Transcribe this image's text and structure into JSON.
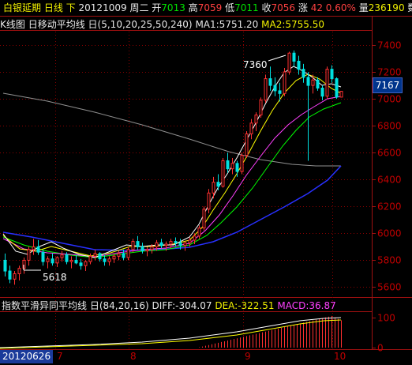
{
  "header": {
    "symbol": "白银延期",
    "period": "日线",
    "direction": "下",
    "date": "20121009",
    "weekday": "周二",
    "open_label": "开",
    "open": "7013",
    "high_label": "高",
    "high": "7059",
    "low_label": "低",
    "low": "7011",
    "close_label": "收",
    "close": "7056",
    "change_label": "涨",
    "change": "42",
    "change_pct": "0.60%",
    "volume_label": "量",
    "volume": "236190",
    "extra_label": "数",
    "extra": "16"
  },
  "ma_bar": {
    "chart_name": "K线图",
    "indicator": "日移动平均线",
    "indicator_params": "日(5,10,20,25,50,240)",
    "ma1": "MA1:5751.20",
    "ma2": "MA2:5755.50"
  },
  "macd_bar": {
    "indicator": "指数平滑异同平均线",
    "params": "日(84,20,16)",
    "diff": "DIFF:-304.07",
    "dea": "DEA:-322.51",
    "macd": "MACD:36.87"
  },
  "price_axis": {
    "ticks": [
      "7400",
      "7200",
      "7000",
      "6800",
      "6600",
      "6400",
      "6200",
      "6000",
      "5800",
      "5600"
    ],
    "current": "7167"
  },
  "macd_axis": {
    "ticks": [
      "100",
      "0"
    ]
  },
  "time_axis": {
    "labels": [
      "2",
      "7",
      "8",
      "9",
      "10"
    ],
    "start_date": "20120626"
  },
  "annotations": {
    "high": "7360",
    "low": "5618"
  },
  "colors": {
    "background": "#000000",
    "up_candle": "#ff3030",
    "down_candle": "#00e0e0",
    "axis_red": "#a01010",
    "ma5": "#ffffff",
    "ma10": "#ffff00",
    "ma20": "#ff40ff",
    "ma25": "#00ff00",
    "ma50": "#3030ff",
    "ma240": "#808080"
  },
  "chart_data": {
    "type": "candlestick",
    "x_axis_months": [
      "7",
      "8",
      "9",
      "10"
    ],
    "ylim": [
      5550,
      7500
    ],
    "candles": [
      [
        5800,
        5850,
        5680,
        5720
      ],
      [
        5720,
        5760,
        5630,
        5660
      ],
      [
        5660,
        5720,
        5618,
        5700
      ],
      [
        5700,
        5760,
        5650,
        5740
      ],
      [
        5740,
        5820,
        5700,
        5800
      ],
      [
        5800,
        5900,
        5760,
        5880
      ],
      [
        5880,
        5960,
        5840,
        5900
      ],
      [
        5900,
        5950,
        5840,
        5860
      ],
      [
        5860,
        5880,
        5760,
        5790
      ],
      [
        5790,
        5830,
        5740,
        5810
      ],
      [
        5810,
        5850,
        5760,
        5780
      ],
      [
        5780,
        5830,
        5750,
        5820
      ],
      [
        5820,
        5870,
        5790,
        5840
      ],
      [
        5840,
        5860,
        5770,
        5790
      ],
      [
        5790,
        5830,
        5740,
        5800
      ],
      [
        5800,
        5840,
        5770,
        5780
      ],
      [
        5780,
        5810,
        5730,
        5760
      ],
      [
        5760,
        5800,
        5720,
        5790
      ],
      [
        5790,
        5850,
        5770,
        5830
      ],
      [
        5830,
        5880,
        5800,
        5850
      ],
      [
        5850,
        5860,
        5790,
        5810
      ],
      [
        5810,
        5840,
        5760,
        5790
      ],
      [
        5790,
        5830,
        5760,
        5810
      ],
      [
        5810,
        5850,
        5780,
        5830
      ],
      [
        5830,
        5870,
        5800,
        5850
      ],
      [
        5850,
        5880,
        5800,
        5820
      ],
      [
        5820,
        5900,
        5800,
        5880
      ],
      [
        5880,
        5960,
        5860,
        5940
      ],
      [
        5940,
        5980,
        5880,
        5900
      ],
      [
        5900,
        5930,
        5850,
        5870
      ],
      [
        5870,
        5900,
        5830,
        5880
      ],
      [
        5880,
        5920,
        5850,
        5900
      ],
      [
        5900,
        5950,
        5870,
        5930
      ],
      [
        5930,
        5960,
        5890,
        5910
      ],
      [
        5910,
        5940,
        5870,
        5920
      ],
      [
        5920,
        5960,
        5890,
        5940
      ],
      [
        5940,
        5970,
        5900,
        5930
      ],
      [
        5930,
        5960,
        5880,
        5910
      ],
      [
        5910,
        5940,
        5870,
        5930
      ],
      [
        5930,
        5970,
        5900,
        5950
      ],
      [
        5950,
        6000,
        5920,
        5980
      ],
      [
        5980,
        6060,
        5960,
        6040
      ],
      [
        6040,
        6200,
        6020,
        6180
      ],
      [
        6180,
        6330,
        6150,
        6300
      ],
      [
        6300,
        6420,
        6260,
        6380
      ],
      [
        6380,
        6440,
        6320,
        6350
      ],
      [
        6350,
        6560,
        6340,
        6540
      ],
      [
        6540,
        6600,
        6450,
        6480
      ],
      [
        6480,
        6560,
        6440,
        6520
      ],
      [
        6520,
        6540,
        6420,
        6460
      ],
      [
        6460,
        6600,
        6440,
        6580
      ],
      [
        6580,
        6760,
        6560,
        6740
      ],
      [
        6740,
        6850,
        6700,
        6820
      ],
      [
        6820,
        6900,
        6760,
        6880
      ],
      [
        6880,
        7010,
        6860,
        6990
      ],
      [
        6990,
        7180,
        6970,
        7150
      ],
      [
        7150,
        7240,
        7060,
        7100
      ],
      [
        7100,
        7160,
        7020,
        7060
      ],
      [
        7060,
        7120,
        6980,
        7040
      ],
      [
        7040,
        7230,
        7020,
        7200
      ],
      [
        7200,
        7350,
        7180,
        7340
      ],
      [
        7340,
        7360,
        7240,
        7280
      ],
      [
        7280,
        7320,
        7180,
        7220
      ],
      [
        7220,
        7260,
        7120,
        7160
      ],
      [
        7160,
        7200,
        6540,
        7100
      ],
      [
        7100,
        7180,
        7040,
        7140
      ],
      [
        7140,
        7160,
        7060,
        7080
      ],
      [
        7080,
        7100,
        6990,
        7020
      ],
      [
        7020,
        7240,
        7000,
        7220
      ],
      [
        7220,
        7250,
        7120,
        7150
      ],
      [
        7150,
        7160,
        7000,
        7013
      ],
      [
        7013,
        7059,
        7011,
        7056
      ]
    ],
    "macd_hist_range": [
      0,
      110
    ]
  }
}
